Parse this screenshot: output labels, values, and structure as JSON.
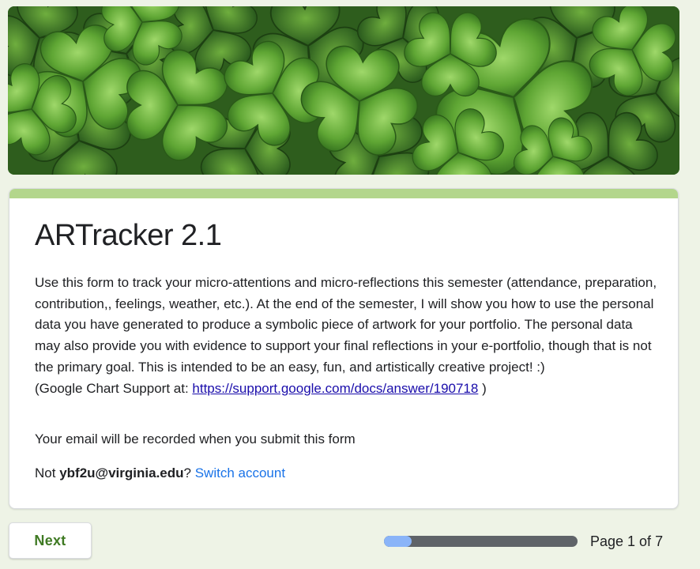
{
  "header": {
    "image_name": "clover-leaves-banner"
  },
  "form": {
    "title": "ARTracker 2.1",
    "description_text": "Use this form to track your micro-attentions and micro-reflections this semester (attendance, preparation, contribution,, feelings, weather, etc.). At the end of the semester, I will show you how to use the personal data you have generated to produce a symbolic piece of artwork for your portfolio.  The personal data may also provide you with evidence to support your final reflections in your e-portfolio, though that is not the primary goal.  This is intended to be an easy, fun, and artistically creative project! :)",
    "chart_support_prefix": "(Google Chart Support at: ",
    "chart_support_link": "https://support.google.com/docs/answer/190718",
    "chart_support_suffix": " )",
    "email_notice": "Your email will be recorded when you submit this form",
    "account_prefix": "Not ",
    "account_email": "ybf2u@virginia.edu",
    "account_suffix": "? ",
    "switch_account_label": "Switch account"
  },
  "navigation": {
    "next_label": "Next",
    "page_indicator": "Page 1 of 7",
    "progress_fraction": 0.143
  },
  "colors": {
    "accent": "#b3d68c",
    "background": "#eef3e6",
    "next_text": "#3f7a23",
    "link": "#1a73e8",
    "progress_fill": "#8ab4f8",
    "progress_track": "#5f6368"
  }
}
